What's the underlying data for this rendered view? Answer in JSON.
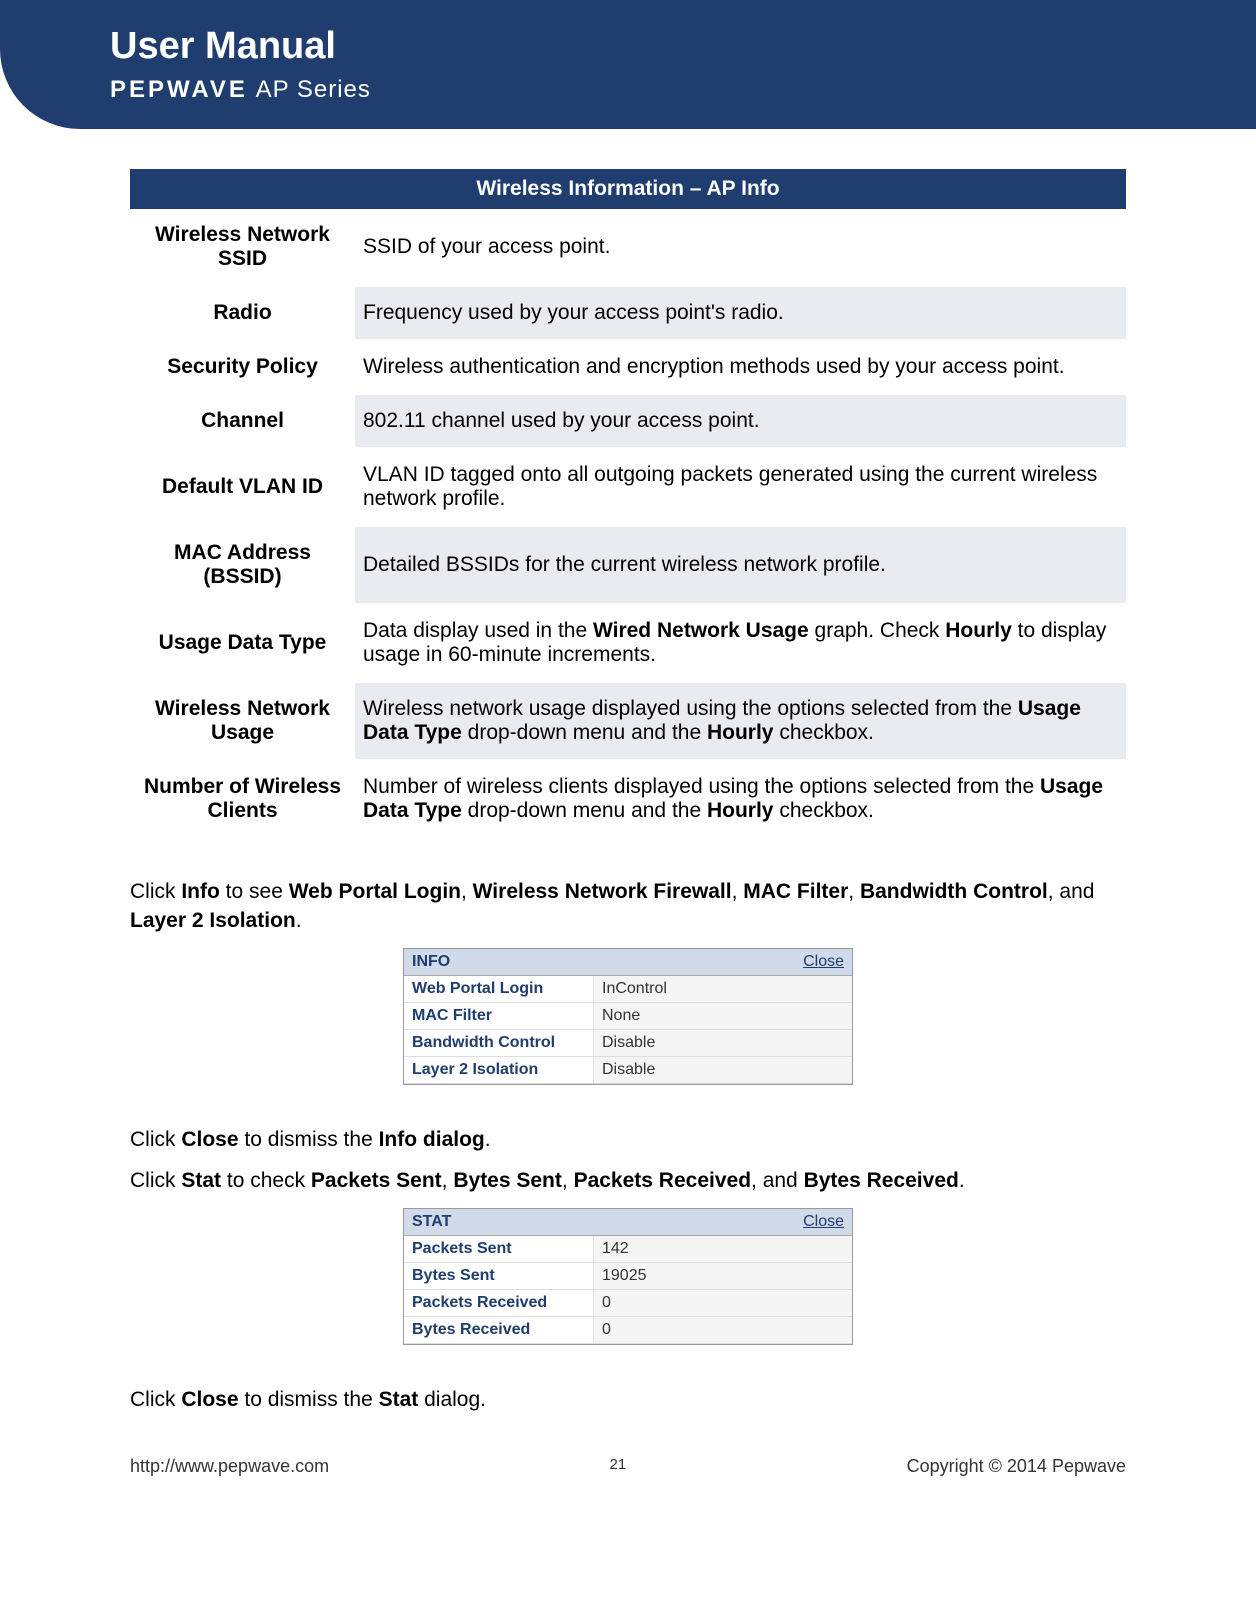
{
  "header": {
    "title": "User Manual",
    "brand": "PEPWAVE",
    "series": "AP Series"
  },
  "table": {
    "title": "Wireless Information – AP Info",
    "rows": [
      {
        "label": "Wireless Network SSID",
        "desc": "SSID of your access point."
      },
      {
        "label": "Radio",
        "desc": "Frequency used by your access point's radio."
      },
      {
        "label": "Security Policy",
        "desc": "Wireless authentication and encryption methods used by your access point."
      },
      {
        "label": "Channel",
        "desc": "802.11 channel used by your access point."
      },
      {
        "label": "Default VLAN ID",
        "desc": "VLAN ID tagged onto all outgoing packets generated using the current wireless network profile."
      },
      {
        "label": "MAC Address (BSSID)",
        "desc": "Detailed BSSIDs for the current wireless network profile."
      }
    ]
  },
  "table_rich": {
    "usage_data_type": {
      "label": "Usage Data Type",
      "p1": "Data display used in the ",
      "b1": "Wired Network Usage",
      "p2": " graph. Check ",
      "b2": "Hourly",
      "p3": " to display usage in 60-minute increments."
    },
    "wireless_usage": {
      "label": "Wireless Network Usage",
      "p1": "Wireless network usage displayed using the options selected from the ",
      "b1": "Usage Data Type",
      "p2": " drop-down menu and the ",
      "b2": "Hourly",
      "p3": " checkbox."
    },
    "num_clients": {
      "label": "Number of Wireless Clients",
      "p1": "Number of wireless clients displayed using the options selected from the ",
      "b1": "Usage Data Type",
      "p2": " drop-down menu and the ",
      "b2": "Hourly",
      "p3": " checkbox."
    }
  },
  "para1": {
    "p1": "Click ",
    "b1": "Info",
    "p2": " to see ",
    "b2": "Web Portal Login",
    "p3": ", ",
    "b3": "Wireless Network Firewall",
    "p4": ", ",
    "b4": "MAC Filter",
    "p5": ", ",
    "b5": "Bandwidth Control",
    "p6": ", and ",
    "b6": "Layer 2 Isolation",
    "p7": "."
  },
  "info_dialog": {
    "title": "INFO",
    "close": "Close",
    "rows": [
      {
        "key": "Web Portal Login",
        "val": "InControl"
      },
      {
        "key": "MAC Filter",
        "val": "None"
      },
      {
        "key": "Bandwidth Control",
        "val": "Disable"
      },
      {
        "key": "Layer 2 Isolation",
        "val": "Disable"
      }
    ]
  },
  "para2": {
    "p1": "Click ",
    "b1": "Close",
    "p2": " to dismiss the ",
    "b2": "Info dialog",
    "p3": "."
  },
  "para3": {
    "p1": "Click ",
    "b1": "Stat",
    "p2": " to check ",
    "b2": "Packets Sent",
    "p3": ", ",
    "b3": "Bytes Sent",
    "p4": ", ",
    "b4": "Packets Received",
    "p5": ", and ",
    "b5": "Bytes Received",
    "p6": "."
  },
  "stat_dialog": {
    "title": "STAT",
    "close": "Close",
    "rows": [
      {
        "key": "Packets Sent",
        "val": "142"
      },
      {
        "key": "Bytes Sent",
        "val": "19025"
      },
      {
        "key": "Packets Received",
        "val": "0"
      },
      {
        "key": "Bytes Received",
        "val": "0"
      }
    ]
  },
  "para4": {
    "p1": "Click ",
    "b1": "Close",
    "p2": " to dismiss the ",
    "b2": "Stat",
    "p3": " dialog."
  },
  "footer": {
    "url": "http://www.pepwave.com",
    "page": "21",
    "copyright": "Copyright © 2014 Pepwave"
  }
}
